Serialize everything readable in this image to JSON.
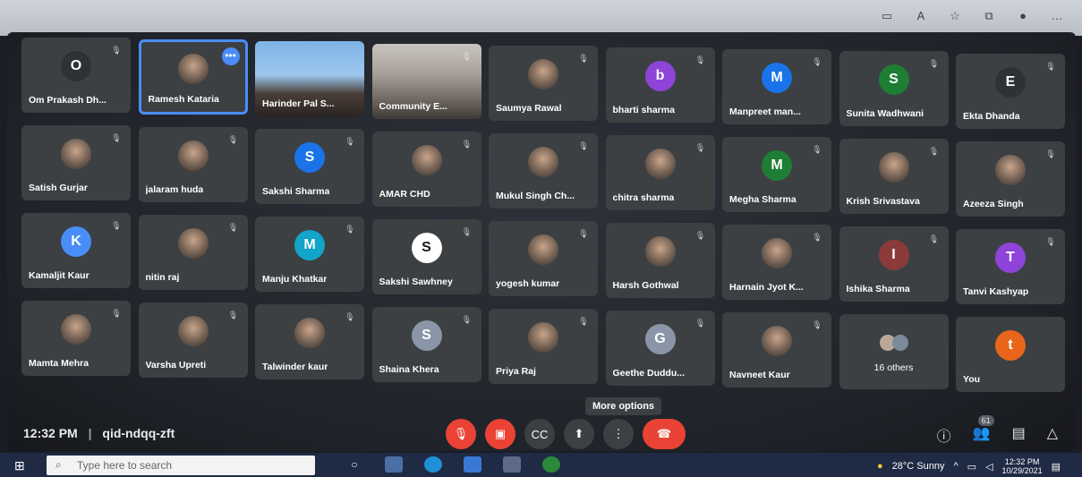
{
  "meeting": {
    "time": "12:32 PM",
    "separator": "|",
    "code": "qid-ndqq-zft",
    "tooltip": "More options",
    "people_count": "61"
  },
  "participants": [
    {
      "name": "Om Prakash Dh...",
      "initial": "O",
      "avatar_type": "letter",
      "color": "#2e3136"
    },
    {
      "name": "Ramesh Kataria",
      "initial": "",
      "avatar_type": "photo",
      "active": true
    },
    {
      "name": "Harinder Pal S...",
      "initial": "",
      "avatar_type": "video"
    },
    {
      "name": "Community E...",
      "initial": "",
      "avatar_type": "video2"
    },
    {
      "name": "Saumya Rawal",
      "initial": "",
      "avatar_type": "photo"
    },
    {
      "name": "bharti sharma",
      "initial": "b",
      "avatar_type": "letter",
      "color": "#8e44d8"
    },
    {
      "name": "Manpreet man...",
      "initial": "M",
      "avatar_type": "letter",
      "color": "#1a73e8"
    },
    {
      "name": "Sunita Wadhwani",
      "initial": "S",
      "avatar_type": "letter",
      "color": "#1e7e34"
    },
    {
      "name": "Ekta Dhanda",
      "initial": "E",
      "avatar_type": "letter",
      "color": "#2e3136"
    },
    {
      "name": "Satish Gurjar",
      "initial": "",
      "avatar_type": "photo"
    },
    {
      "name": "jalaram huda",
      "initial": "",
      "avatar_type": "photo"
    },
    {
      "name": "Sakshi Sharma",
      "initial": "S",
      "avatar_type": "letter",
      "color": "#1a73e8"
    },
    {
      "name": "AMAR CHD",
      "initial": "",
      "avatar_type": "photo"
    },
    {
      "name": "Mukul Singh Ch...",
      "initial": "",
      "avatar_type": "photo"
    },
    {
      "name": "chitra sharma",
      "initial": "",
      "avatar_type": "photo"
    },
    {
      "name": "Megha Sharma",
      "initial": "M",
      "avatar_type": "letter",
      "color": "#1e7e34"
    },
    {
      "name": "Krish Srivastava",
      "initial": "",
      "avatar_type": "photo"
    },
    {
      "name": "Azeeza Singh",
      "initial": "",
      "avatar_type": "photo"
    },
    {
      "name": "Kamaljit Kaur",
      "initial": "K",
      "avatar_type": "letter",
      "color": "#4a8df8"
    },
    {
      "name": "nitin raj",
      "initial": "",
      "avatar_type": "photo"
    },
    {
      "name": "Manju Khatkar",
      "initial": "M",
      "avatar_type": "letter",
      "color": "#12a4c9"
    },
    {
      "name": "Sakshi Sawhney",
      "initial": "S",
      "avatar_type": "letter",
      "color": "#ffffff",
      "fg": "#1a1a1a"
    },
    {
      "name": "yogesh kumar",
      "initial": "",
      "avatar_type": "photo"
    },
    {
      "name": "Harsh Gothwal",
      "initial": "",
      "avatar_type": "photo"
    },
    {
      "name": "Harnain Jyot K...",
      "initial": "",
      "avatar_type": "photo"
    },
    {
      "name": "Ishika Sharma",
      "initial": "I",
      "avatar_type": "letter",
      "color": "#8b3a3a"
    },
    {
      "name": "Tanvi Kashyap",
      "initial": "T",
      "avatar_type": "letter",
      "color": "#8e44d8"
    },
    {
      "name": "Mamta Mehra",
      "initial": "",
      "avatar_type": "photo"
    },
    {
      "name": "Varsha Upreti",
      "initial": "",
      "avatar_type": "photo"
    },
    {
      "name": "Talwinder kaur",
      "initial": "",
      "avatar_type": "photo"
    },
    {
      "name": "Shaina Khera",
      "initial": "S",
      "avatar_type": "letter",
      "color": "#8a96a8"
    },
    {
      "name": "Priya Raj",
      "initial": "",
      "avatar_type": "photo"
    },
    {
      "name": "Geethe Duddu...",
      "initial": "G",
      "avatar_type": "letter",
      "color": "#8a96a8"
    },
    {
      "name": "Navneet Kaur",
      "initial": "",
      "avatar_type": "photo"
    },
    {
      "name": "16 others",
      "initial": "",
      "avatar_type": "group"
    },
    {
      "name": "You",
      "initial": "t",
      "avatar_type": "letter",
      "color": "#e8651a"
    }
  ],
  "taskbar": {
    "search_placeholder": "Type here to search",
    "weather": "28°C Sunny",
    "clock_time": "12:32 PM",
    "clock_date": "10/29/2021"
  },
  "icons": {
    "mic_off": "mic-off-icon",
    "camera_off": "camera-off-icon",
    "captions": "captions-icon",
    "present": "present-icon",
    "more": "more-vert-icon",
    "hangup": "hangup-icon",
    "info": "info-icon",
    "people": "people-icon",
    "chat": "chat-icon",
    "activities": "activities-icon"
  }
}
